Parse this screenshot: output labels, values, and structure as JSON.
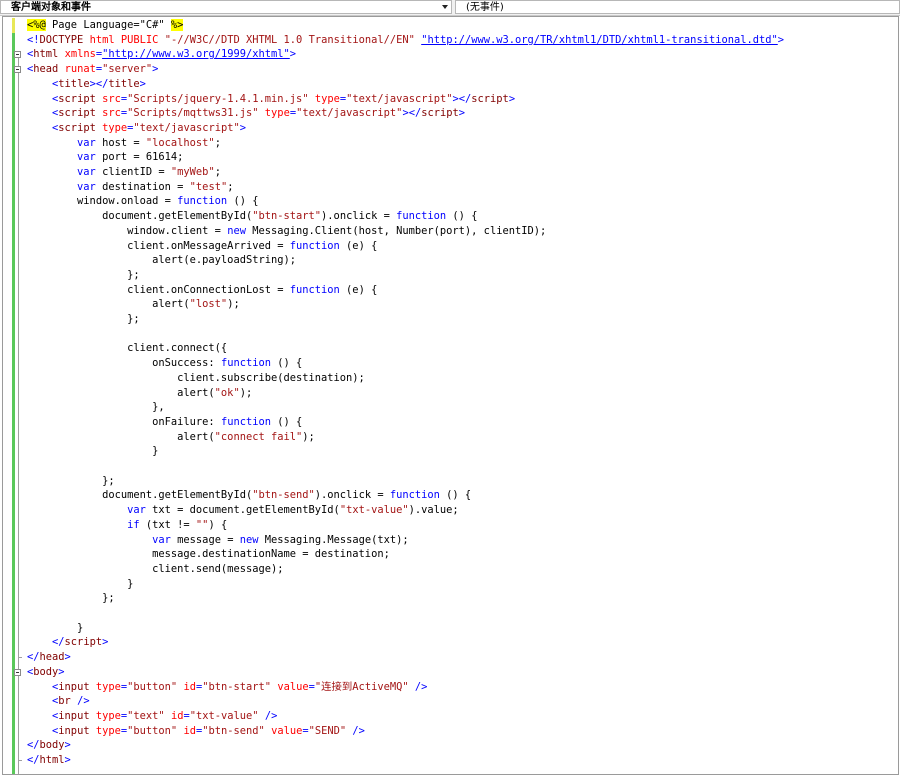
{
  "toolbar": {
    "object_dropdown": "客户端对象和事件",
    "event_dropdown": "(无事件)"
  },
  "code_lines": [
    [
      [
        "dir",
        "<%@"
      ],
      [
        "txt",
        " Page Language=\"C#\" "
      ],
      [
        "dir",
        "%>"
      ]
    ],
    [
      [
        "bl",
        "<!"
      ],
      [
        "tag",
        "DOCTYPE"
      ],
      [
        "txt",
        " "
      ],
      [
        "attr",
        "html"
      ],
      [
        "txt",
        " "
      ],
      [
        "attr",
        "PUBLIC"
      ],
      [
        "txt",
        " "
      ],
      [
        "str",
        "\"-//W3C//DTD XHTML 1.0 Transitional//EN\""
      ],
      [
        "txt",
        " "
      ],
      [
        "link",
        "\"http://www.w3.org/TR/xhtml1/DTD/xhtml1-transitional.dtd\""
      ],
      [
        "bl",
        ">"
      ]
    ],
    [
      [
        "bl",
        "<"
      ],
      [
        "tag",
        "html"
      ],
      [
        "txt",
        " "
      ],
      [
        "attr",
        "xmlns"
      ],
      [
        "bl",
        "="
      ],
      [
        "link",
        "\"http://www.w3.org/1999/xhtml\""
      ],
      [
        "bl",
        ">"
      ]
    ],
    [
      [
        "bl",
        "<"
      ],
      [
        "tag",
        "head"
      ],
      [
        "txt",
        " "
      ],
      [
        "attr",
        "runat"
      ],
      [
        "bl",
        "="
      ],
      [
        "str",
        "\"server\""
      ],
      [
        "bl",
        ">"
      ]
    ],
    [
      [
        "txt",
        "    "
      ],
      [
        "bl",
        "<"
      ],
      [
        "tag",
        "title"
      ],
      [
        "bl",
        "></"
      ],
      [
        "tag",
        "title"
      ],
      [
        "bl",
        ">"
      ]
    ],
    [
      [
        "txt",
        "    "
      ],
      [
        "bl",
        "<"
      ],
      [
        "tag",
        "script"
      ],
      [
        "txt",
        " "
      ],
      [
        "attr",
        "src"
      ],
      [
        "bl",
        "="
      ],
      [
        "str",
        "\"Scripts/jquery-1.4.1.min.js\""
      ],
      [
        "txt",
        " "
      ],
      [
        "attr",
        "type"
      ],
      [
        "bl",
        "="
      ],
      [
        "str",
        "\"text/javascript\""
      ],
      [
        "bl",
        "></"
      ],
      [
        "tag",
        "script"
      ],
      [
        "bl",
        ">"
      ]
    ],
    [
      [
        "txt",
        "    "
      ],
      [
        "bl",
        "<"
      ],
      [
        "tag",
        "script"
      ],
      [
        "txt",
        " "
      ],
      [
        "attr",
        "src"
      ],
      [
        "bl",
        "="
      ],
      [
        "str",
        "\"Scripts/mqttws31.js\""
      ],
      [
        "txt",
        " "
      ],
      [
        "attr",
        "type"
      ],
      [
        "bl",
        "="
      ],
      [
        "str",
        "\"text/javascript\""
      ],
      [
        "bl",
        "></"
      ],
      [
        "tag",
        "script"
      ],
      [
        "bl",
        ">"
      ]
    ],
    [
      [
        "txt",
        "    "
      ],
      [
        "bl",
        "<"
      ],
      [
        "tag",
        "script"
      ],
      [
        "txt",
        " "
      ],
      [
        "attr",
        "type"
      ],
      [
        "bl",
        "="
      ],
      [
        "str",
        "\"text/javascript\""
      ],
      [
        "bl",
        ">"
      ]
    ],
    [
      [
        "txt",
        "        "
      ],
      [
        "kw",
        "var"
      ],
      [
        "txt",
        " host = "
      ],
      [
        "str",
        "\"localhost\""
      ],
      [
        "txt",
        ";"
      ]
    ],
    [
      [
        "txt",
        "        "
      ],
      [
        "kw",
        "var"
      ],
      [
        "txt",
        " port = 61614;"
      ]
    ],
    [
      [
        "txt",
        "        "
      ],
      [
        "kw",
        "var"
      ],
      [
        "txt",
        " clientID = "
      ],
      [
        "str",
        "\"myWeb\""
      ],
      [
        "txt",
        ";"
      ]
    ],
    [
      [
        "txt",
        "        "
      ],
      [
        "kw",
        "var"
      ],
      [
        "txt",
        " destination = "
      ],
      [
        "str",
        "\"test\""
      ],
      [
        "txt",
        ";"
      ]
    ],
    [
      [
        "txt",
        "        window.onload = "
      ],
      [
        "kw",
        "function"
      ],
      [
        "txt",
        " () {"
      ]
    ],
    [
      [
        "txt",
        "            document.getElementById("
      ],
      [
        "str",
        "\"btn-start\""
      ],
      [
        "txt",
        ").onclick = "
      ],
      [
        "kw",
        "function"
      ],
      [
        "txt",
        " () {"
      ]
    ],
    [
      [
        "txt",
        "                window.client = "
      ],
      [
        "kw",
        "new"
      ],
      [
        "txt",
        " Messaging.Client(host, Number(port), clientID);"
      ]
    ],
    [
      [
        "txt",
        "                client.onMessageArrived = "
      ],
      [
        "kw",
        "function"
      ],
      [
        "txt",
        " (e) {"
      ]
    ],
    [
      [
        "txt",
        "                    alert(e.payloadString);"
      ]
    ],
    [
      [
        "txt",
        "                };"
      ]
    ],
    [
      [
        "txt",
        "                client.onConnectionLost = "
      ],
      [
        "kw",
        "function"
      ],
      [
        "txt",
        " (e) {"
      ]
    ],
    [
      [
        "txt",
        "                    alert("
      ],
      [
        "str",
        "\"lost\""
      ],
      [
        "txt",
        ");"
      ]
    ],
    [
      [
        "txt",
        "                };"
      ]
    ],
    [
      [
        "txt",
        ""
      ]
    ],
    [
      [
        "txt",
        "                client.connect({"
      ]
    ],
    [
      [
        "txt",
        "                    onSuccess: "
      ],
      [
        "kw",
        "function"
      ],
      [
        "txt",
        " () {"
      ]
    ],
    [
      [
        "txt",
        "                        client.subscribe(destination);"
      ]
    ],
    [
      [
        "txt",
        "                        alert("
      ],
      [
        "str",
        "\"ok\""
      ],
      [
        "txt",
        ");"
      ]
    ],
    [
      [
        "txt",
        "                    },"
      ]
    ],
    [
      [
        "txt",
        "                    onFailure: "
      ],
      [
        "kw",
        "function"
      ],
      [
        "txt",
        " () {"
      ]
    ],
    [
      [
        "txt",
        "                        alert("
      ],
      [
        "str",
        "\"connect fail\""
      ],
      [
        "txt",
        ");"
      ]
    ],
    [
      [
        "txt",
        "                    }"
      ]
    ],
    [
      [
        "txt",
        ""
      ]
    ],
    [
      [
        "txt",
        "            };"
      ]
    ],
    [
      [
        "txt",
        "            document.getElementById("
      ],
      [
        "str",
        "\"btn-send\""
      ],
      [
        "txt",
        ").onclick = "
      ],
      [
        "kw",
        "function"
      ],
      [
        "txt",
        " () {"
      ]
    ],
    [
      [
        "txt",
        "                "
      ],
      [
        "kw",
        "var"
      ],
      [
        "txt",
        " txt = document.getElementById("
      ],
      [
        "str",
        "\"txt-value\""
      ],
      [
        "txt",
        ").value;"
      ]
    ],
    [
      [
        "txt",
        "                "
      ],
      [
        "kw",
        "if"
      ],
      [
        "txt",
        " (txt != "
      ],
      [
        "str",
        "\"\""
      ],
      [
        "txt",
        ") {"
      ]
    ],
    [
      [
        "txt",
        "                    "
      ],
      [
        "kw",
        "var"
      ],
      [
        "txt",
        " message = "
      ],
      [
        "kw",
        "new"
      ],
      [
        "txt",
        " Messaging.Message(txt);"
      ]
    ],
    [
      [
        "txt",
        "                    message.destinationName = destination;"
      ]
    ],
    [
      [
        "txt",
        "                    client.send(message);"
      ]
    ],
    [
      [
        "txt",
        "                }"
      ]
    ],
    [
      [
        "txt",
        "            };"
      ]
    ],
    [
      [
        "txt",
        ""
      ]
    ],
    [
      [
        "txt",
        "        }"
      ]
    ],
    [
      [
        "txt",
        "    "
      ],
      [
        "bl",
        "</"
      ],
      [
        "tag",
        "script"
      ],
      [
        "bl",
        ">"
      ]
    ],
    [
      [
        "bl",
        "</"
      ],
      [
        "tag",
        "head"
      ],
      [
        "bl",
        ">"
      ]
    ],
    [
      [
        "bl",
        "<"
      ],
      [
        "tag",
        "body"
      ],
      [
        "bl",
        ">"
      ]
    ],
    [
      [
        "txt",
        "    "
      ],
      [
        "bl",
        "<"
      ],
      [
        "tag",
        "input"
      ],
      [
        "txt",
        " "
      ],
      [
        "attr",
        "type"
      ],
      [
        "bl",
        "="
      ],
      [
        "str",
        "\"button\""
      ],
      [
        "txt",
        " "
      ],
      [
        "attr",
        "id"
      ],
      [
        "bl",
        "="
      ],
      [
        "str",
        "\"btn-start\""
      ],
      [
        "txt",
        " "
      ],
      [
        "attr",
        "value"
      ],
      [
        "bl",
        "="
      ],
      [
        "str",
        "\"连接到ActiveMQ\""
      ],
      [
        "txt",
        " "
      ],
      [
        "bl",
        "/>"
      ]
    ],
    [
      [
        "txt",
        "    "
      ],
      [
        "bl",
        "<"
      ],
      [
        "tag",
        "br"
      ],
      [
        "txt",
        " "
      ],
      [
        "bl",
        "/>"
      ]
    ],
    [
      [
        "txt",
        "    "
      ],
      [
        "bl",
        "<"
      ],
      [
        "tag",
        "input"
      ],
      [
        "txt",
        " "
      ],
      [
        "attr",
        "type"
      ],
      [
        "bl",
        "="
      ],
      [
        "str",
        "\"text\""
      ],
      [
        "txt",
        " "
      ],
      [
        "attr",
        "id"
      ],
      [
        "bl",
        "="
      ],
      [
        "str",
        "\"txt-value\""
      ],
      [
        "txt",
        " "
      ],
      [
        "bl",
        "/>"
      ]
    ],
    [
      [
        "txt",
        "    "
      ],
      [
        "bl",
        "<"
      ],
      [
        "tag",
        "input"
      ],
      [
        "txt",
        " "
      ],
      [
        "attr",
        "type"
      ],
      [
        "bl",
        "="
      ],
      [
        "str",
        "\"button\""
      ],
      [
        "txt",
        " "
      ],
      [
        "attr",
        "id"
      ],
      [
        "bl",
        "="
      ],
      [
        "str",
        "\"btn-send\""
      ],
      [
        "txt",
        " "
      ],
      [
        "attr",
        "value"
      ],
      [
        "bl",
        "="
      ],
      [
        "str",
        "\"SEND\""
      ],
      [
        "txt",
        " "
      ],
      [
        "bl",
        "/>"
      ]
    ],
    [
      [
        "bl",
        "</"
      ],
      [
        "tag",
        "body"
      ],
      [
        "bl",
        ">"
      ]
    ],
    [
      [
        "bl",
        "</"
      ],
      [
        "tag",
        "html"
      ],
      [
        "bl",
        ">"
      ]
    ]
  ]
}
